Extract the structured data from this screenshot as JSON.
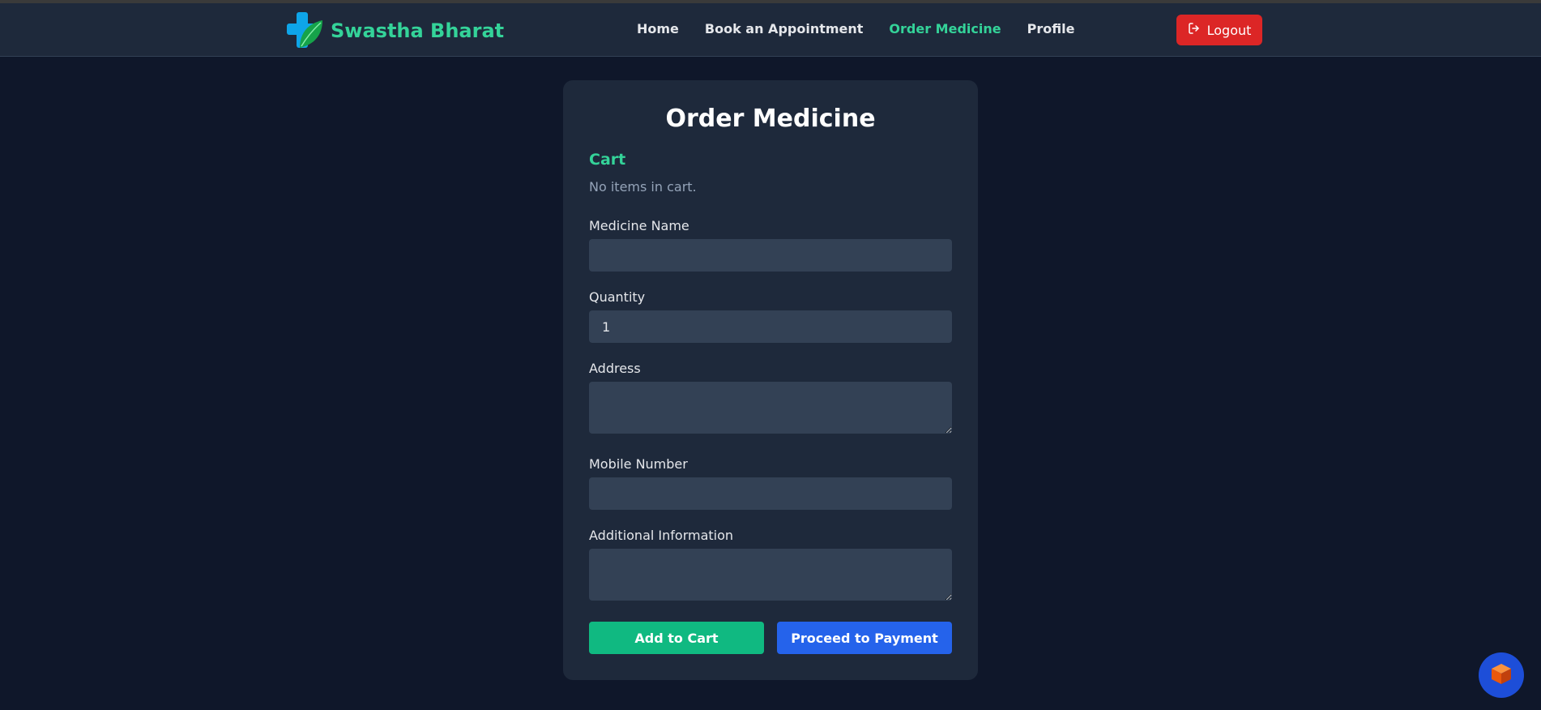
{
  "brand": {
    "name": "Swastha Bharat"
  },
  "nav": {
    "items": [
      {
        "label": "Home",
        "active": false
      },
      {
        "label": "Book an Appointment",
        "active": false
      },
      {
        "label": "Order Medicine",
        "active": true
      },
      {
        "label": "Profile",
        "active": false
      }
    ],
    "logout_label": "Logout"
  },
  "order_form": {
    "title": "Order Medicine",
    "cart_heading": "Cart",
    "cart_empty_text": "No items in cart.",
    "medicine_name": {
      "label": "Medicine Name",
      "value": ""
    },
    "quantity": {
      "label": "Quantity",
      "value": "1"
    },
    "address": {
      "label": "Address",
      "value": ""
    },
    "mobile": {
      "label": "Mobile Number",
      "value": ""
    },
    "additional_info": {
      "label": "Additional Information",
      "value": ""
    },
    "add_to_cart_label": "Add to Cart",
    "proceed_label": "Proceed to Payment"
  },
  "colors": {
    "page_bg": "#0f172a",
    "card_bg": "#1e293b",
    "accent_green": "#34d399",
    "button_green": "#10b981",
    "button_blue": "#2563eb",
    "logout_red": "#dc2626"
  },
  "icons": {
    "brand_logo": "medical-cross-leaf-icon",
    "logout": "logout-icon",
    "fab": "orange-cube-icon"
  }
}
